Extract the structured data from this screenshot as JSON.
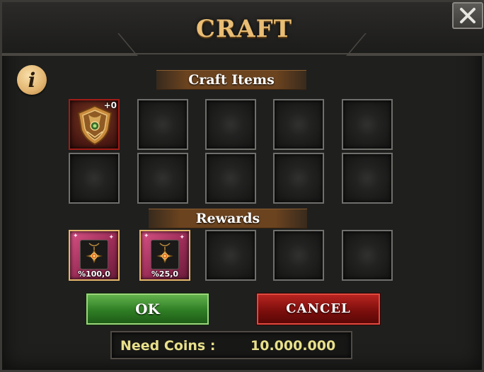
{
  "window": {
    "title": "CRAFT",
    "close_icon": "close-icon",
    "info_icon": "info-icon",
    "info_glyph": "i"
  },
  "craft_items": {
    "heading": "Craft Items",
    "slots": [
      {
        "filled": true,
        "item": "crest-shield-item",
        "enhance": "+0"
      },
      {
        "filled": false
      },
      {
        "filled": false
      },
      {
        "filled": false
      },
      {
        "filled": false
      },
      {
        "filled": false
      },
      {
        "filled": false
      },
      {
        "filled": false
      },
      {
        "filled": false
      },
      {
        "filled": false
      }
    ]
  },
  "rewards": {
    "heading": "Rewards",
    "slots": [
      {
        "filled": true,
        "item": "amulet-item",
        "chance": "%100,0"
      },
      {
        "filled": true,
        "item": "amulet-item",
        "chance": "%25,0"
      },
      {
        "filled": false
      },
      {
        "filled": false
      },
      {
        "filled": false
      }
    ]
  },
  "actions": {
    "ok_label": "OK",
    "cancel_label": "CANCEL"
  },
  "cost": {
    "label": "Need Coins :",
    "value": "10.000.000"
  },
  "colors": {
    "title": "#e9bd74",
    "ok": "#2f7d24",
    "cancel": "#7d0f0d",
    "coins_text": "#e8e08a",
    "reward_slot": "#c8437a",
    "craft_slot_filled": "#a11c16"
  }
}
